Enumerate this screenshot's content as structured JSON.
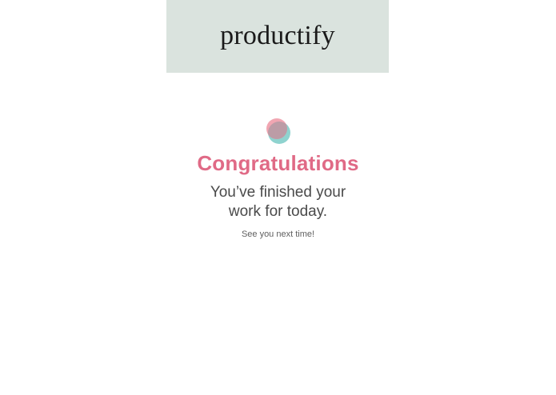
{
  "header": {
    "brand": "productify",
    "background_color": "#dae3de"
  },
  "logo": {
    "icon": "overlapping-circles-icon",
    "colors": {
      "pink": "#f1a6b2",
      "teal": "#8fd3cf",
      "overlap": "#b39aa3"
    }
  },
  "main": {
    "title": "Congratulations",
    "message_line1": "You’ve finished your",
    "message_line2": "work for today.",
    "note": "See you next time!",
    "accent_color": "#e06a86"
  }
}
